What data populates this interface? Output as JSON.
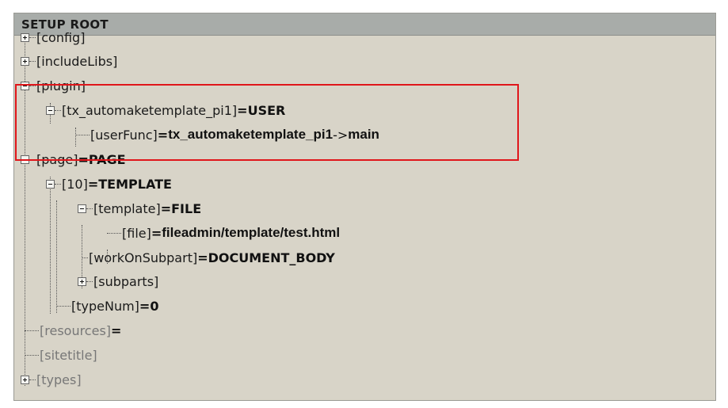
{
  "header": {
    "title": "SETUP ROOT"
  },
  "tree": {
    "config": "[config]",
    "includeLibs": "[includeLibs]",
    "plugin": "[plugin]",
    "pi1_key": "[tx_automaketemplate_pi1]",
    "pi1_eq": "=",
    "pi1_val": "USER",
    "userFunc_key": "[userFunc]",
    "userFunc_eq": "=",
    "userFunc_val": "tx_automaketemplate_pi1",
    "userFunc_arrow": "->",
    "userFunc_val2": "main",
    "page_key": "[page]",
    "page_eq": "=",
    "page_val": "PAGE",
    "n10_key": "[10]",
    "n10_eq": "=",
    "n10_val": "TEMPLATE",
    "template_key": "[template]",
    "template_eq": "=",
    "template_val": "FILE",
    "file_key": "[file]",
    "file_eq": "=",
    "file_val": "fileadmin/template/test.html",
    "wos_key": "[workOnSubpart]",
    "wos_eq": "=",
    "wos_val": "DOCUMENT_BODY",
    "subparts": "[subparts]",
    "typeNum_key": "[typeNum]",
    "typeNum_eq": "=",
    "typeNum_val": "0",
    "resources_key": "[resources]",
    "resources_eq": "=",
    "sitetitle": "[sitetitle]",
    "types": "[types]"
  },
  "colors": {
    "panel_bg": "#d8d4c8",
    "header_bg": "#a8aca9",
    "highlight_border": "#e0161b",
    "dim_text": "#777777"
  }
}
